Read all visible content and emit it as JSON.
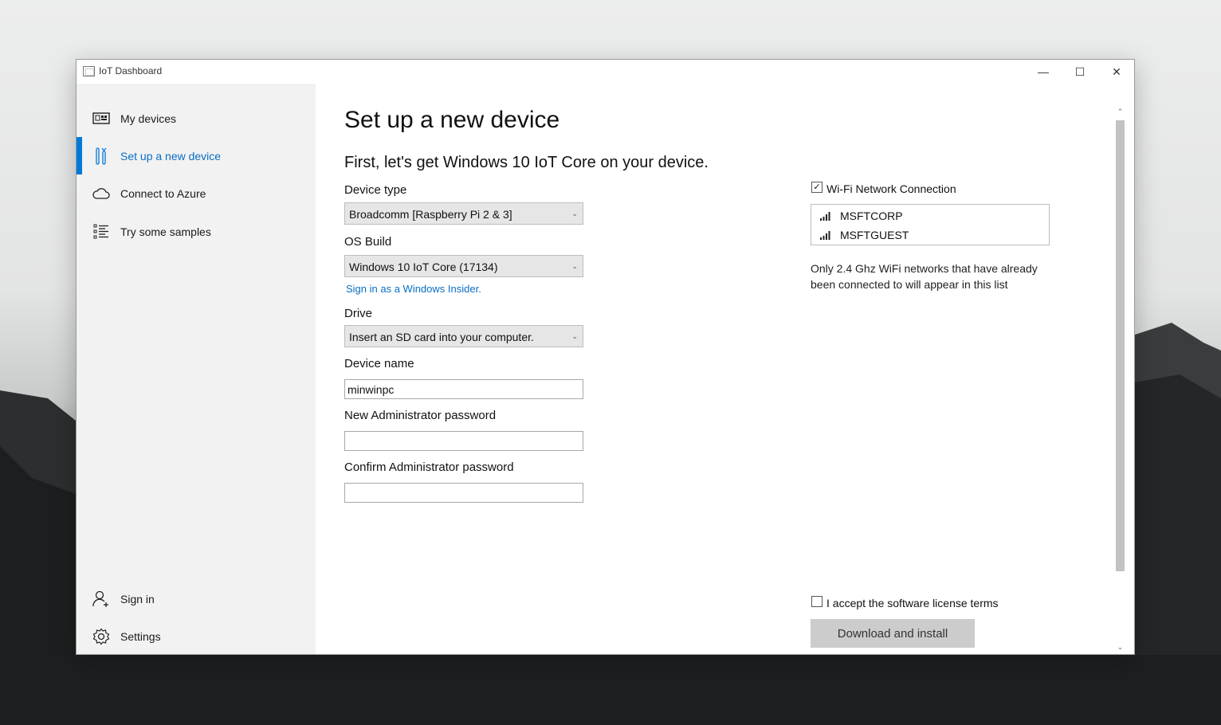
{
  "window": {
    "title": "IoT Dashboard"
  },
  "window_controls": {
    "minimize": "—",
    "maximize": "☐",
    "close": "✕"
  },
  "sidebar": {
    "items": [
      {
        "label": "My devices",
        "icon": "devices-icon"
      },
      {
        "label": "Set up a new device",
        "icon": "setup-icon",
        "active": true
      },
      {
        "label": "Connect to Azure",
        "icon": "cloud-icon"
      },
      {
        "label": "Try some samples",
        "icon": "list-icon"
      }
    ],
    "bottom_items": [
      {
        "label": "Sign in",
        "icon": "add-user-icon"
      },
      {
        "label": "Settings",
        "icon": "gear-icon"
      }
    ]
  },
  "main": {
    "title": "Set up a new device",
    "subtitle": "First, let's get Windows 10 IoT Core on your device.",
    "device_type": {
      "label": "Device type",
      "value": "Broadcomm [Raspberry Pi 2 & 3]"
    },
    "os_build": {
      "label": "OS Build",
      "value": "Windows 10 IoT Core (17134)"
    },
    "insider_link": "Sign in as a Windows Insider.",
    "drive": {
      "label": "Drive",
      "value": "Insert an SD card into your computer."
    },
    "device_name": {
      "label": "Device name",
      "value": "minwinpc"
    },
    "admin_password": {
      "label": "New Administrator password",
      "value": ""
    },
    "confirm_password": {
      "label": "Confirm Administrator password",
      "value": ""
    },
    "wifi": {
      "label": "Wi-Fi Network Connection",
      "checked": true,
      "networks": [
        "MSFTCORP",
        "MSFTGUEST"
      ],
      "note": "Only 2.4 Ghz WiFi networks that have already been connected to will appear in this list"
    },
    "license": {
      "label": "I accept the software license terms",
      "checked": false
    },
    "install_button": "Download and install"
  },
  "colors": {
    "accent": "#0078d7",
    "link": "#0a6ec4",
    "sidebar_bg": "#f2f2f2",
    "button_disabled": "#cccccc"
  }
}
